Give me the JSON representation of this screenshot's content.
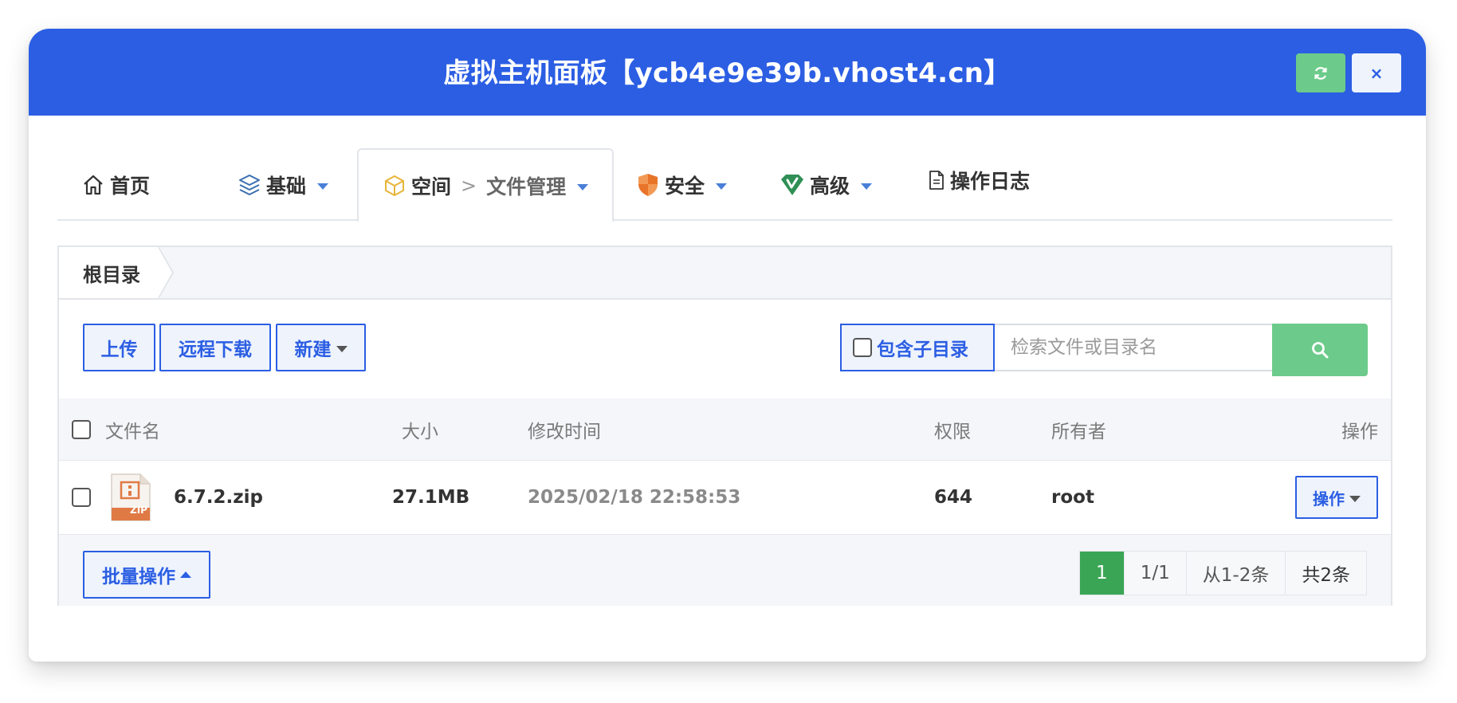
{
  "modal": {
    "title": "虚拟主机面板【ycb4e9e39b.vhost4.cn】",
    "refresh_icon": "refresh-icon",
    "close_label": "×"
  },
  "tabs": [
    {
      "label": "首页",
      "icon": "home-icon"
    },
    {
      "label": "基础",
      "icon": "layers-icon",
      "has_dropdown": true
    },
    {
      "label": "空间",
      "sub_label": "文件管理",
      "separator": ">",
      "icon": "box-icon",
      "has_dropdown": true,
      "active": true
    },
    {
      "label": "安全",
      "icon": "shield-icon",
      "has_dropdown": true
    },
    {
      "label": "高级",
      "icon": "gem-icon",
      "has_dropdown": true
    },
    {
      "label": "操作日志",
      "icon": "document-icon"
    }
  ],
  "breadcrumb": {
    "root_label": "根目录"
  },
  "toolbar": {
    "upload_label": "上传",
    "remote_download_label": "远程下载",
    "new_label": "新建",
    "include_subdir_label": "包含子目录",
    "search_placeholder": "检索文件或目录名"
  },
  "table": {
    "headers": {
      "name": "文件名",
      "size": "大小",
      "modified": "修改时间",
      "permission": "权限",
      "owner": "所有者",
      "actions": "操作"
    },
    "rows": [
      {
        "name": "6.7.2.zip",
        "file_type_badge": "ZIP",
        "size": "27.1MB",
        "modified": "2025/02/18 22:58:53",
        "permission": "644",
        "owner": "root",
        "action_label": "操作"
      }
    ]
  },
  "footer": {
    "batch_label": "批量操作",
    "pagination": {
      "current": "1",
      "pages": "1/1",
      "range": "从1-2条",
      "total": "共2条"
    }
  },
  "colors": {
    "primary": "#2b5ee3",
    "success": "#6ccb8a",
    "active_page": "#3aa655"
  }
}
